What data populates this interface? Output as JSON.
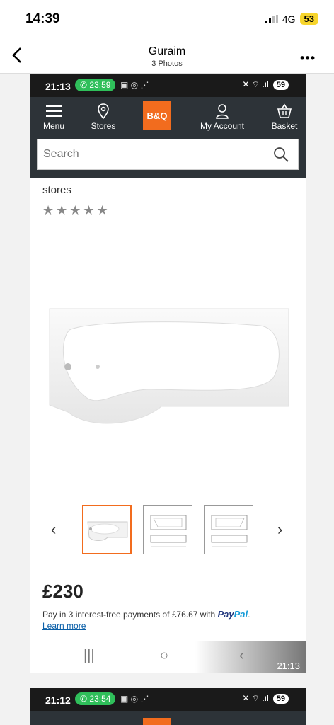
{
  "ios_status": {
    "time": "14:39",
    "network": "4G",
    "battery": "53"
  },
  "viewer": {
    "title": "Guraim",
    "subtitle": "3 Photos"
  },
  "screenshot1": {
    "android_status": {
      "time": "21:13",
      "call_timer": "23:59",
      "battery": "59"
    },
    "nav": {
      "menu": "Menu",
      "stores": "Stores",
      "logo": "B&Q",
      "account": "My Account",
      "basket": "Basket"
    },
    "search": {
      "placeholder": "Search"
    },
    "stores_text": "stores",
    "stars": "★★★★★",
    "price": "£230",
    "paypal_text": "Pay in 3 interest-free payments of £76.67 with",
    "paypal_brand": "Pay",
    "paypal_brand2": "Pal",
    "learn_more": "Learn more",
    "timestamp": "21:13"
  },
  "screenshot2": {
    "android_status": {
      "time": "21:12",
      "call_timer": "23:54",
      "battery": "59"
    }
  },
  "colors": {
    "bq_orange": "#f26c1e",
    "bq_dark": "#2d3338",
    "call_green": "#2fbf5a"
  }
}
